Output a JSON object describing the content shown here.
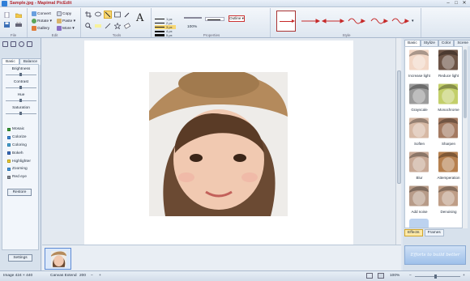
{
  "window": {
    "title": "Sample.jpg - Mapimal PicEdit",
    "controls": [
      "–",
      "□",
      "✕"
    ]
  },
  "ribbon": {
    "file_buttons": [
      {
        "label": "Convert",
        "icon": "convert-icon"
      },
      {
        "label": "Copy",
        "icon": "copy-icon"
      },
      {
        "label": "Rotate ▾",
        "icon": "rotate-icon"
      },
      {
        "label": "Paste ▾",
        "icon": "paste-icon"
      },
      {
        "label": "Gallery",
        "icon": "gallery-icon"
      },
      {
        "label": "More ▾",
        "icon": "more-icon"
      }
    ],
    "line_widths": [
      "1 px",
      "2 px",
      "3 px",
      "4 px",
      "5 px"
    ],
    "zoom": "100%",
    "outline_label": "Outline ▾",
    "group_labels": [
      "File",
      "Edit",
      "Tools",
      "Properties",
      "Style"
    ]
  },
  "left_panel": {
    "tabs": [
      "Basic",
      "Balance"
    ],
    "adjustments": [
      "Brightness",
      "Contrast",
      "Hue",
      "Saturation"
    ],
    "effects": [
      "Mosaic",
      "Colorize",
      "Coloring",
      "Bokeh",
      "Highlighter",
      "Zooming",
      "Red eye"
    ],
    "restore_label": "Restore",
    "settings_label": "Settings"
  },
  "right_panel": {
    "tabs": [
      "Basic",
      "Stylize",
      "Color",
      "Scene"
    ],
    "effects": [
      {
        "label": "Increase light",
        "tint": "#f2d7c6"
      },
      {
        "label": "Reduce light",
        "tint": "#6c5446"
      },
      {
        "label": "Grayscale",
        "tint": "#9b9b9b"
      },
      {
        "label": "Monochrome",
        "tint": "#c3cf6a"
      },
      {
        "label": "Soften",
        "tint": "#d7b9a5"
      },
      {
        "label": "Sharpen",
        "tint": "#a47a61"
      },
      {
        "label": "Blur",
        "tint": "#c8a996"
      },
      {
        "label": "Attemperation",
        "tint": "#b6804f"
      },
      {
        "label": "Add noise",
        "tint": "#b79b88"
      },
      {
        "label": "Denoising",
        "tint": "#bf9e87"
      }
    ],
    "bottom_tabs": [
      "Effects",
      "Frames"
    ],
    "banner": "Efforts to build better"
  },
  "statusbar": {
    "image_info": "Image  424 × 440",
    "canvas_label": "Canvas Extend",
    "canvas_value": "200",
    "canvas_minus": "−",
    "canvas_plus": "+",
    "zoom": "100%",
    "zoom_minus": "−",
    "zoom_plus": "+"
  }
}
